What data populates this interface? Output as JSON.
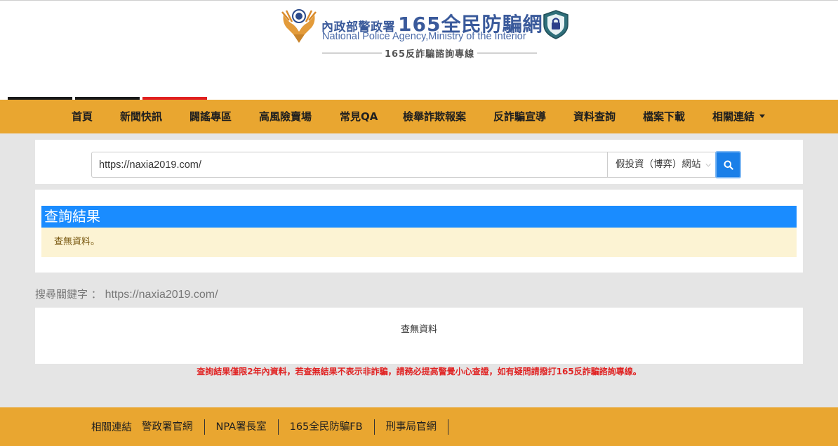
{
  "header": {
    "agency_zh": "內政部警政署",
    "site_zh": "165全民防騙網",
    "agency_en": "National Police Agency,Ministry of the Interior",
    "hotline": "165反詐騙諮詢專線",
    "tab_bar_colors": [
      "#1a1a1a",
      "#1a1a1a",
      "#e02020"
    ]
  },
  "nav": {
    "items": [
      {
        "label": "首頁"
      },
      {
        "label": "新聞快訊"
      },
      {
        "label": "闢謠專區"
      },
      {
        "label": "高風險賣場"
      },
      {
        "label": "常見QA"
      },
      {
        "label": "檢舉詐欺報案"
      },
      {
        "label": "反詐騙宣導"
      },
      {
        "label": "資料查詢"
      },
      {
        "label": "檔案下載"
      },
      {
        "label": "相關連結",
        "has_dropdown": true
      }
    ]
  },
  "search": {
    "input_value": "https://naxia2019.com/",
    "category_selected": "假投資（博弈）網站",
    "button_icon": "search-icon"
  },
  "result": {
    "heading": "查詢結果",
    "message": "查無資料。"
  },
  "keyword": {
    "label": "搜尋關鍵字 ：",
    "value": "https://naxia2019.com/"
  },
  "nodata": {
    "text": "查無資料"
  },
  "disclaimer": "查詢結果僅限2年內資料，若查無結果不表示非詐騙，請務必提高警覺小心查證，如有疑問請撥打165反詐騙諮詢專線。",
  "footer": {
    "label": "相關連結",
    "links": [
      "警政署官網",
      "NPA署長室",
      "165全民防騙FB",
      "刑事局官網"
    ]
  },
  "colors": {
    "nav_bg": "#e9a630",
    "result_heading_bg": "#1a8cff",
    "alert_bg": "#fcf3d3",
    "search_button": "#1a7fe8",
    "disclaimer": "#e02424",
    "brand_blue": "#3a5a9b"
  }
}
